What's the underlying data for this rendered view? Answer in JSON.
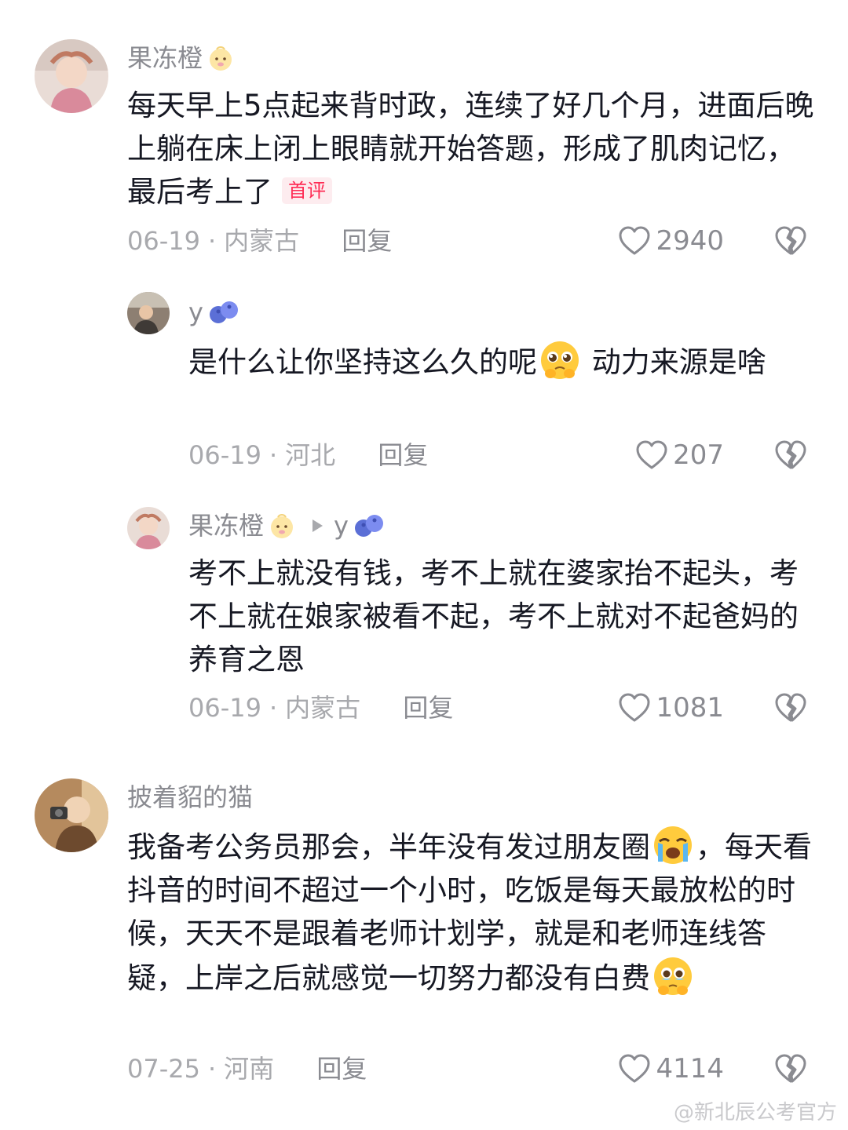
{
  "comments": [
    {
      "username": "果冻橙",
      "text": "每天早上5点起来背时政，连续了好几个月，进面后晚上躺在床上闭上眼睛就开始答题，形成了肌肉记忆，最后考上了",
      "tag": "首评",
      "date": "06-19",
      "location": "内蒙古",
      "reply_label": "回复",
      "likes": "2940",
      "badge_icon": "baby-emoji-icon"
    },
    {
      "username": "y",
      "text_before": "是什么让你坚持这么久的呢",
      "text_after": " 动力来源是啥",
      "inline_emoji": "pleading-emoji-icon",
      "date": "06-19",
      "location": "河北",
      "reply_label": "回复",
      "likes": "207",
      "badge_icon": "blueberry-emoji-icon"
    },
    {
      "username": "果冻橙",
      "reply_to": "y",
      "text": "考不上就没有钱，考不上就在婆家抬不起头，考不上就在娘家被看不起，考不上就对不起爸妈的养育之恩",
      "date": "06-19",
      "location": "内蒙古",
      "reply_label": "回复",
      "likes": "1081"
    },
    {
      "username": "披着貂的猫",
      "text_before": "我备考公务员那会，半年没有发过朋友圈",
      "text_middle": "，每天看抖音的时间不超过一个小时，吃饭是每天最放松的时候，天天不是跟着老师计划学，就是和老师连线答疑，上岸之后就感觉一切努力都没有白费",
      "inline_emoji_1": "loudly-crying-emoji-icon",
      "inline_emoji_2": "holding-back-tears-emoji-icon",
      "date": "07-25",
      "location": "河南",
      "reply_label": "回复",
      "likes": "4114"
    }
  ],
  "separator": "·",
  "watermark": "@新北辰公考官方",
  "colors": {
    "text": "#161823",
    "meta": "#a8a9ad",
    "tag_text": "#fe2c55",
    "tag_bg": "#fdecef"
  }
}
